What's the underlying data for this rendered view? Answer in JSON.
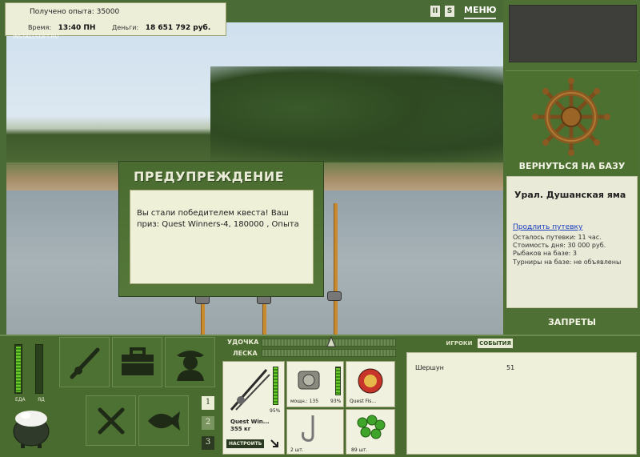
{
  "hud": {
    "experience": "Получено опыта: 35000",
    "time_label": "Время:",
    "time_value": "13:40 ПН",
    "money_label": "Деньги:",
    "money_value": "18 651 792 руб.",
    "watermark": "INSTALLSOFT.RU"
  },
  "top_buttons": {
    "pause": "II",
    "sound": "S",
    "menu": "МЕНЮ"
  },
  "right_panel": {
    "return_label": "ВЕРНУТЬСЯ НА БАЗУ",
    "location": "Урал. Душанская яма",
    "extend_link": "Продлить путевку",
    "trip_left": "Осталось путевки: 11 час.",
    "day_cost": "Стоимость дня: 30 000 руб.",
    "fishers": "Рыбаков на базе: 3",
    "tournaments": "Турниры на базе: не объявлены",
    "bans_label": "ЗАПРЕТЫ"
  },
  "dialog": {
    "title": "ПРЕДУПРЕЖДЕНИЕ",
    "message": "Вы стали победителем квеста! Ваш приз: Quest Winners-4, 180000 , Опыта"
  },
  "status_bars": {
    "food_label": "ЕДА",
    "poison_label": "ЯД",
    "food_level": 0.95,
    "poison_level": 0.0
  },
  "pages": [
    "1",
    "2",
    "3"
  ],
  "gauges": {
    "rod_label": "УДОЧКА",
    "line_label": "ЛЕСКА"
  },
  "inventory": {
    "rod_name": "Quest Win...",
    "rod_weight": "355 кг",
    "rod_percent": "95%",
    "rod_level": 0.95,
    "setup_button": "НАСТРОИТЬ",
    "reel_power": "мощн.: 135",
    "reel_percent": "93%",
    "reel_level": 0.93,
    "lure_name": "Quest Fis...",
    "hook_count": "2 шт.",
    "bait_count": "89 шт."
  },
  "events": {
    "tab_players": "ИГРОКИ",
    "tab_events": "СОБЫТИЯ",
    "rows": [
      {
        "name": "Шершун",
        "value": "51"
      }
    ]
  },
  "colors": {
    "panel_green": "#4a6b30",
    "light_panel": "#eef0d8",
    "accent_bar": "#69c82a"
  }
}
